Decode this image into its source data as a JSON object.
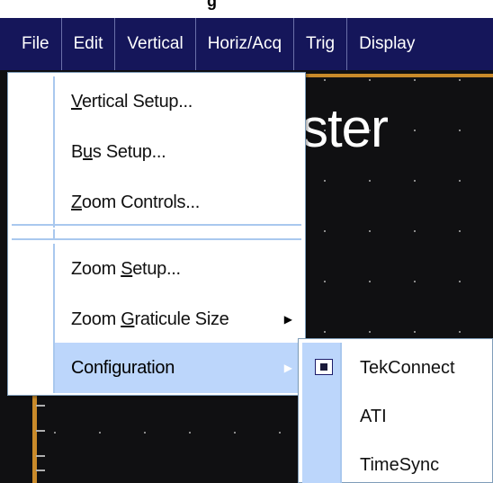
{
  "window": {
    "partial_title": "g"
  },
  "menubar": {
    "items": [
      {
        "label": "File"
      },
      {
        "label": "Edit"
      },
      {
        "label": "Vertical"
      },
      {
        "label": "Horiz/Acq"
      },
      {
        "label": "Trig"
      },
      {
        "label": "Display"
      }
    ]
  },
  "scope": {
    "partial_text": "ster"
  },
  "vertical_menu": {
    "items": [
      {
        "label": "Vertical Setup...",
        "mnemonic": "V"
      },
      {
        "label": "Bus Setup...",
        "mnemonic": "u"
      },
      {
        "label": "Zoom Controls...",
        "mnemonic": "Z"
      },
      {
        "label": "Zoom Setup...",
        "mnemonic": "S"
      },
      {
        "label": "Zoom Graticule Size",
        "mnemonic": "G",
        "submenu": true
      },
      {
        "label": "Configuration",
        "submenu": true,
        "highlighted": true
      }
    ]
  },
  "configuration_submenu": {
    "items": [
      {
        "label": "TekConnect",
        "checked": true
      },
      {
        "label": "ATI",
        "checked": false
      },
      {
        "label": "TimeSync",
        "checked": false
      }
    ]
  },
  "colors": {
    "menubar_bg": "#15165a",
    "highlight": "#bcd6fb",
    "separator": "#a9c8ee",
    "trace_orange": "#c98a2a"
  },
  "icons": {
    "submenu_arrow": "triangle-right",
    "checked": "filled-square"
  }
}
